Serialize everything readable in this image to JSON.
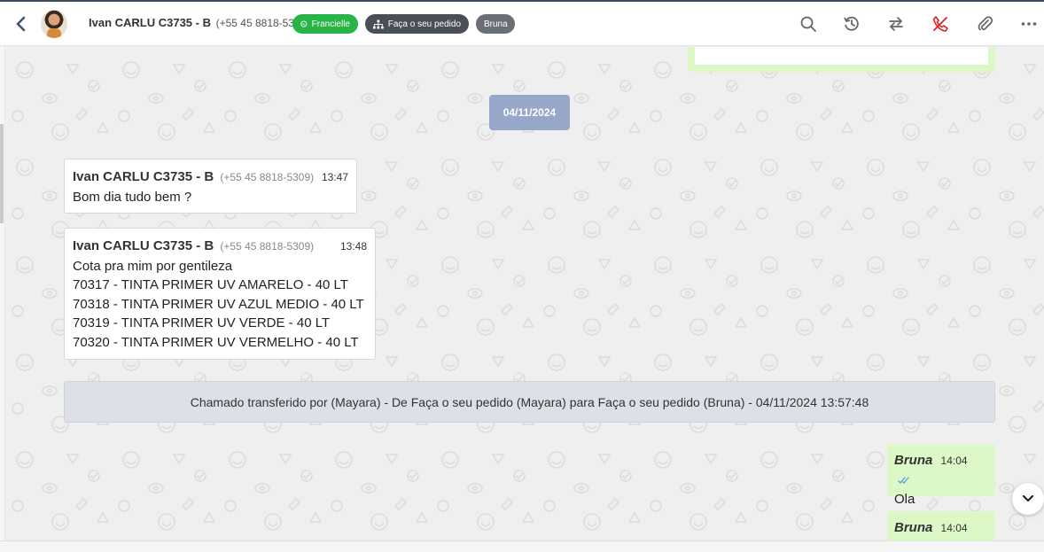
{
  "header": {
    "contact_name": "Ivan CARLU C3735 - B",
    "contact_phone": "(+55 45 8818-5309)",
    "channel_badge": "Francielle",
    "queue_badge": "Faça o seu pedido",
    "agent_badge": "Bruna",
    "icons": [
      "back-icon",
      "search-icon",
      "history-icon",
      "transfer-icon",
      "end-call-icon",
      "attach-icon",
      "more-icon"
    ]
  },
  "chat": {
    "date_separator": "04/11/2024",
    "incoming": [
      {
        "sender": "Ivan CARLU C3735 - B",
        "phone": "(+55 45 8818-5309)",
        "time": "13:47",
        "lines": [
          "Bom dia tudo bem ?"
        ]
      },
      {
        "sender": "Ivan CARLU C3735 - B",
        "phone": "(+55 45 8818-5309)",
        "time": "13:48",
        "lines": [
          "Cota pra mim por gentileza",
          "70317 - TINTA PRIMER UV AMARELO - 40 LT",
          "70318 - TINTA PRIMER UV AZUL MEDIO - 40 LT",
          "70319 - TINTA PRIMER UV VERDE - 40 LT",
          "70320 - TINTA PRIMER UV VERMELHO - 40 LT"
        ]
      }
    ],
    "system_message": "Chamado transferido por (Mayara) - De Faça o seu pedido (Mayara) para Faça o seu pedido (Bruna) - 04/11/2024 13:57:48",
    "outgoing": [
      {
        "sender": "Bruna",
        "time": "14:04",
        "text": "Ola"
      },
      {
        "sender": "Bruna",
        "time": "14:04",
        "text": ""
      }
    ]
  },
  "colors": {
    "outgoing_bubble": "#dcf8c6",
    "date_chip": "#97a7c9",
    "whatsapp_badge": "#28b446",
    "end_call": "#e02020",
    "read_ticks": "#4fa3e0"
  }
}
